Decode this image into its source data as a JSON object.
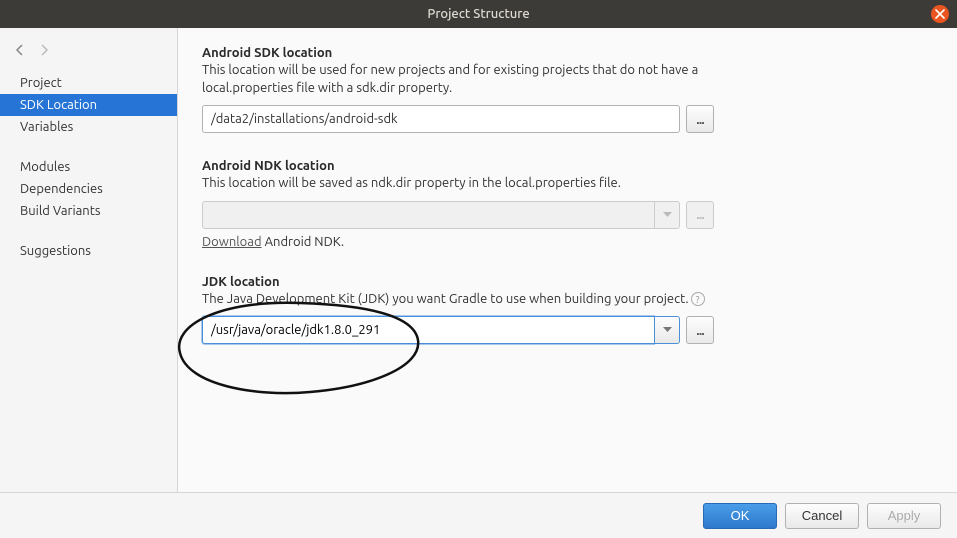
{
  "titlebar": {
    "title": "Project Structure"
  },
  "sidebar": {
    "items": [
      {
        "label": "Project"
      },
      {
        "label": "SDK Location"
      },
      {
        "label": "Variables"
      },
      {
        "label": "Modules"
      },
      {
        "label": "Dependencies"
      },
      {
        "label": "Build Variants"
      },
      {
        "label": "Suggestions"
      }
    ]
  },
  "sections": {
    "android_sdk": {
      "title": "Android SDK location",
      "desc": "This location will be used for new projects and for existing projects that do not have a local.properties file with a sdk.dir property.",
      "value": "/data2/installations/android-sdk",
      "browse": "..."
    },
    "android_ndk": {
      "title": "Android NDK location",
      "desc": "This location will be saved as ndk.dir property in the local.properties file.",
      "value": "",
      "browse": "...",
      "download_link": "Download",
      "download_suffix": " Android NDK."
    },
    "jdk": {
      "title": "JDK location",
      "desc": "The Java Development Kit (JDK) you want Gradle to use when building your project.",
      "value": "/usr/java/oracle/jdk1.8.0_291",
      "browse": "..."
    }
  },
  "footer": {
    "ok": "OK",
    "cancel": "Cancel",
    "apply": "Apply"
  }
}
